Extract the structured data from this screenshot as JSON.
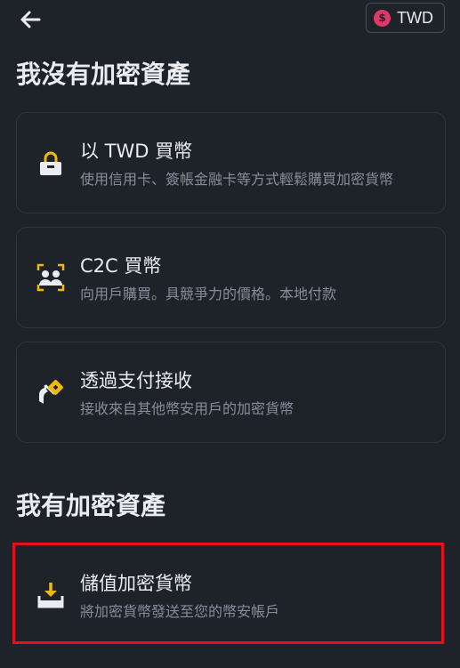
{
  "header": {
    "back_icon": "arrow-left-icon",
    "currency": {
      "symbol": "$",
      "label": "TWD",
      "color": "#e0386a"
    }
  },
  "sections": [
    {
      "title": "我沒有加密資產",
      "items": [
        {
          "icon": "lock-icon",
          "title": "以 TWD 買幣",
          "description": "使用信用卡、簽帳金融卡等方式輕鬆購買加密貨幣"
        },
        {
          "icon": "users-icon",
          "title": "C2C 買幣",
          "description": "向用戶購買。具競爭力的價格。本地付款"
        },
        {
          "icon": "receive-payment-icon",
          "title": "透過支付接收",
          "description": "接收來自其他幣安用戶的加密貨幣"
        }
      ]
    },
    {
      "title": "我有加密資產",
      "items": [
        {
          "icon": "deposit-icon",
          "title": "儲值加密貨幣",
          "description": "將加密貨幣發送至您的幣安帳戶"
        }
      ]
    }
  ],
  "colors": {
    "background": "#1e2329",
    "accent": "#f0b90b",
    "text_primary": "#eaecef",
    "text_secondary": "#848e9c",
    "card_border": "#2f353d",
    "highlight_border": "#e3111d"
  }
}
